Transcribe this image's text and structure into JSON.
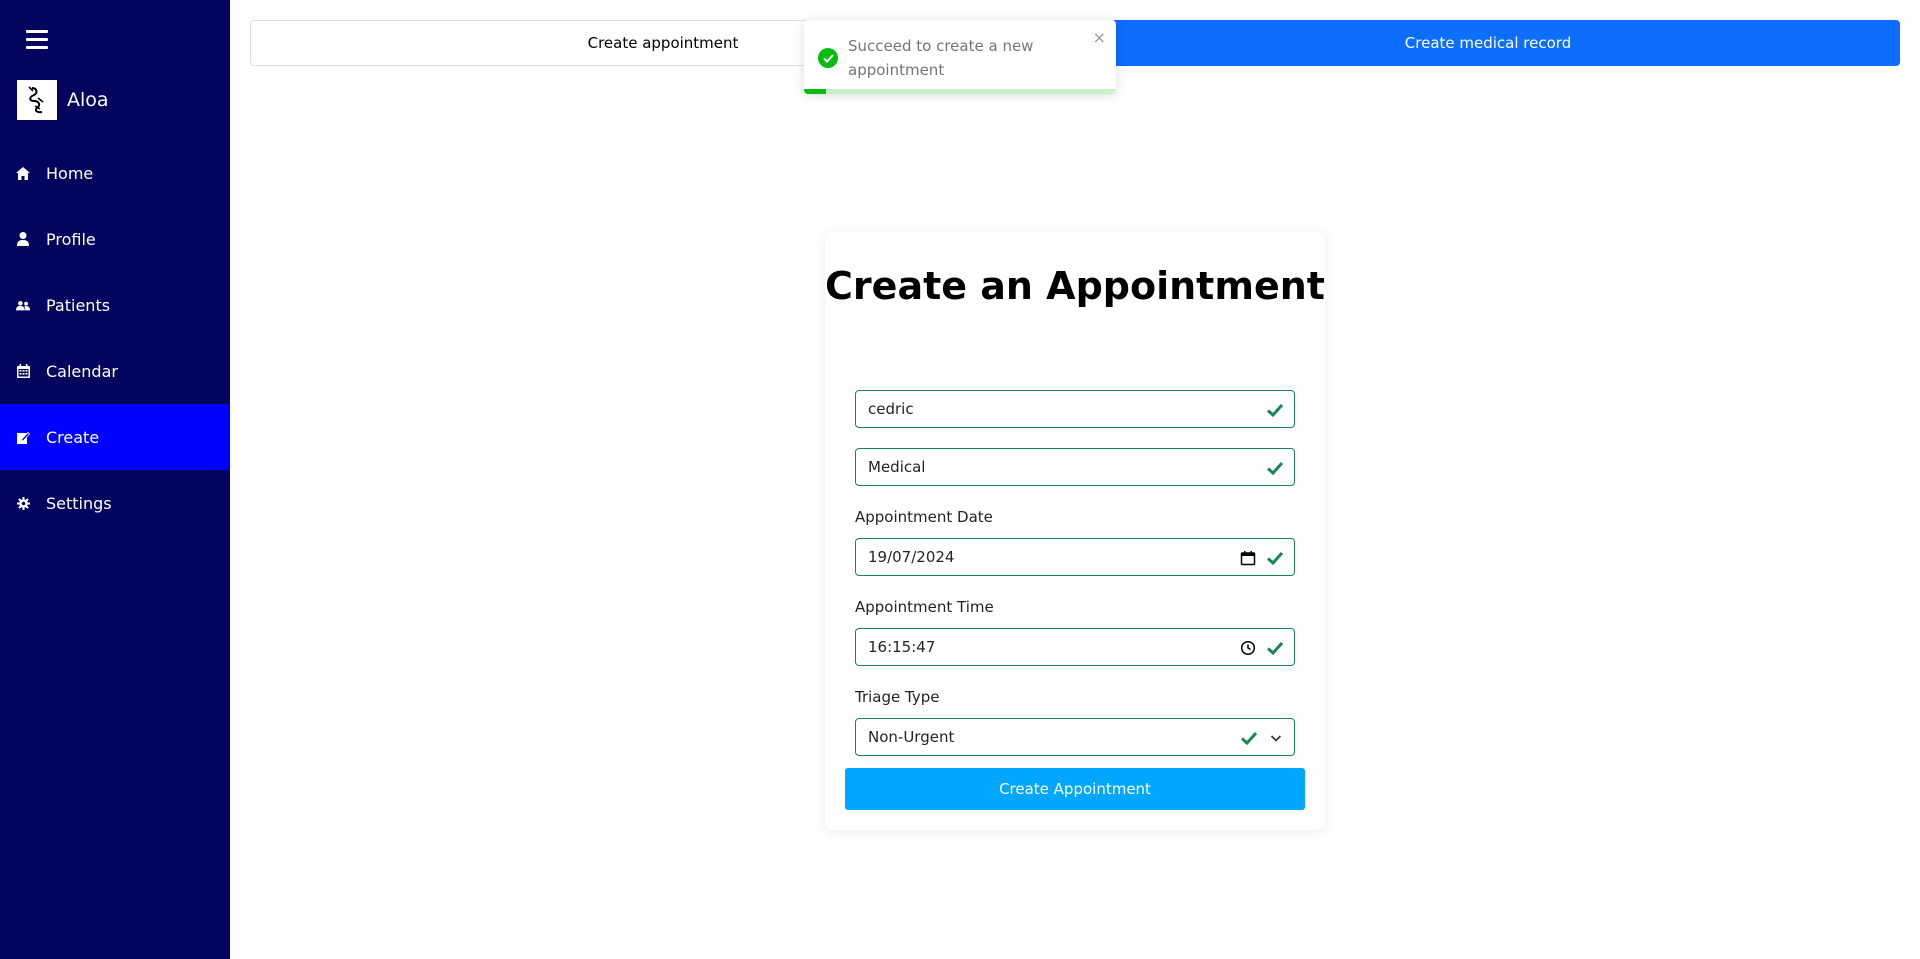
{
  "sidebar": {
    "brand_name": "Aloa",
    "items": [
      {
        "label": "Home",
        "icon": "home-icon"
      },
      {
        "label": "Profile",
        "icon": "user-icon"
      },
      {
        "label": "Patients",
        "icon": "users-icon"
      },
      {
        "label": "Calendar",
        "icon": "calendar-icon"
      },
      {
        "label": "Create",
        "icon": "edit-icon",
        "active": true
      },
      {
        "label": "Settings",
        "icon": "gear-icon"
      }
    ]
  },
  "tabs": {
    "left": "Create appointment",
    "right": "Create medical record"
  },
  "toast": {
    "message": "Succeed to create a new appointment",
    "close": "×",
    "progress": 0.07
  },
  "form": {
    "title": "Create an Appointment",
    "patient_value": "cedric",
    "type_value": "Medical",
    "date_label": "Appointment Date",
    "date_value": "19/07/2024",
    "time_label": "Appointment Time",
    "time_value": "16:15:47",
    "triage_label": "Triage Type",
    "triage_value": "Non-Urgent",
    "submit_label": "Create Appointment"
  },
  "colors": {
    "sidebar_bg": "#03045e",
    "active_item": "#0000ff",
    "tab_active": "#0d6efd",
    "submit": "#00a6ff",
    "valid": "#198754",
    "toast_success": "#07bc0c"
  }
}
